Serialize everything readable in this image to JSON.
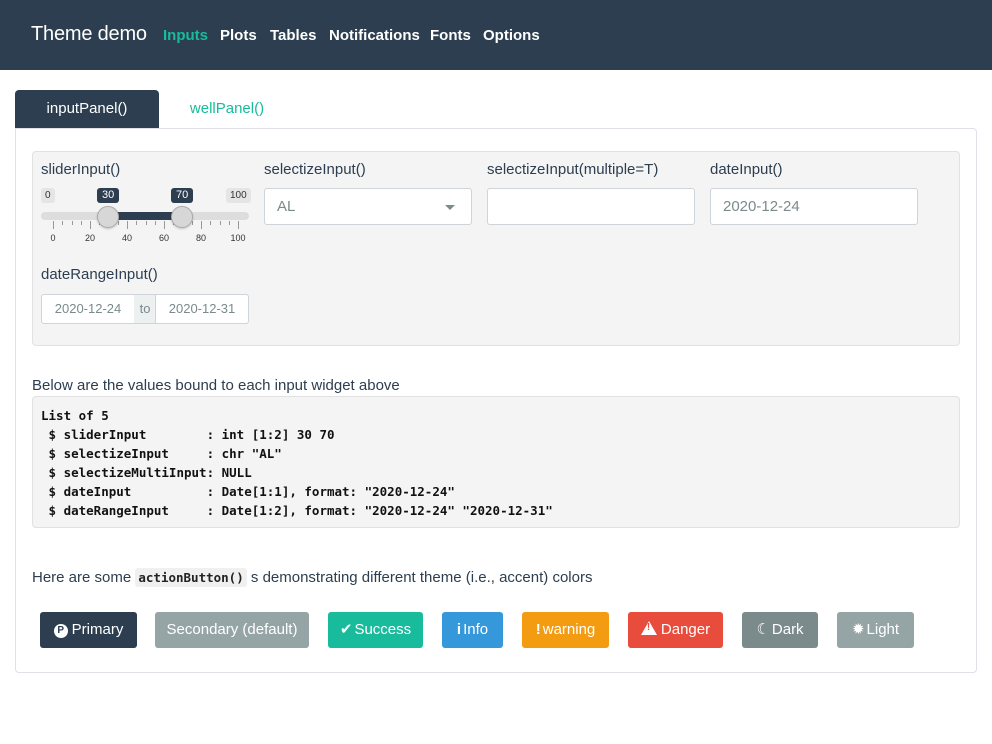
{
  "navbar": {
    "brand": "Theme demo",
    "items": [
      "Inputs",
      "Plots",
      "Tables",
      "Notifications",
      "Fonts",
      "Options"
    ],
    "active": "Inputs"
  },
  "tabs": [
    "inputPanel()",
    "wellPanel()"
  ],
  "inputs": {
    "slider": {
      "label": "sliderInput()",
      "min": "0",
      "max": "100",
      "from": "30",
      "to": "70",
      "ticks": [
        "0",
        "20",
        "40",
        "60",
        "80",
        "100"
      ]
    },
    "selectize": {
      "label": "selectizeInput()",
      "value": "AL"
    },
    "selectize_multi": {
      "label": "selectizeInput(multiple=T)",
      "value": ""
    },
    "date": {
      "label": "dateInput()",
      "value": "2020-12-24"
    },
    "date_range": {
      "label": "dateRangeInput()",
      "start": "2020-12-24",
      "sep": "to",
      "end": "2020-12-31"
    }
  },
  "values": {
    "label": "Below are the values bound to each input widget above",
    "lines": [
      "List of 5",
      " $ sliderInput        : int [1:2] 30 70",
      " $ selectizeInput     : chr \"AL\"",
      " $ selectizeMultiInput: NULL",
      " $ dateInput          : Date[1:1], format: \"2020-12-24\"",
      " $ dateRangeInput     : Date[1:2], format: \"2020-12-24\" \"2020-12-31\""
    ]
  },
  "actions": {
    "prefix": "Here are some ",
    "code": "actionButton()",
    "suffix": " s demonstrating different theme (i.e., accent) colors",
    "buttons": [
      {
        "label": "Primary",
        "color": "#2c3e50",
        "icon": "p-circle-icon"
      },
      {
        "label": "Secondary (default)",
        "color": "#95a5a6",
        "icon": ""
      },
      {
        "label": "Success",
        "color": "#18bc9c",
        "icon": "check-icon"
      },
      {
        "label": "Info",
        "color": "#3498db",
        "icon": "info-icon"
      },
      {
        "label": "warning",
        "color": "#f39c12",
        "icon": "exclamation-icon"
      },
      {
        "label": "Danger",
        "color": "#e74c3c",
        "icon": "warning-triangle-icon"
      },
      {
        "label": "Dark",
        "color": "#7b8a8b",
        "icon": "moon-icon"
      },
      {
        "label": "Light",
        "color": "#95a5a6",
        "icon": "sun-icon"
      }
    ]
  }
}
